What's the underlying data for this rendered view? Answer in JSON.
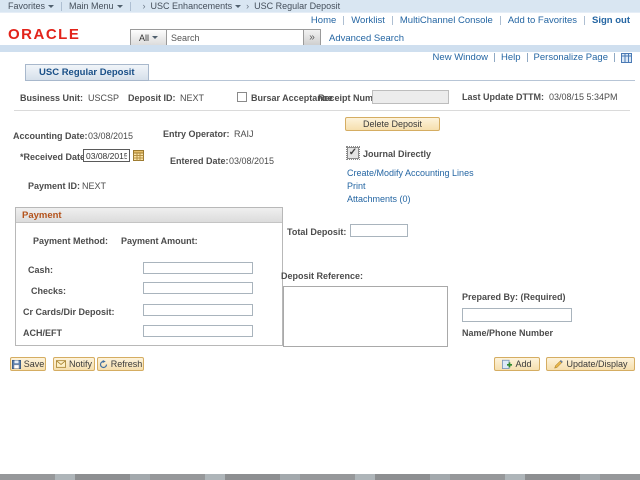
{
  "breadcrumb": {
    "items": [
      {
        "label": "Favorites"
      },
      {
        "label": "Main Menu"
      },
      {
        "label": "USC Enhancements"
      },
      {
        "label": "USC Regular Deposit"
      }
    ],
    "separator": "›"
  },
  "utility_nav": {
    "home": "Home",
    "worklist": "Worklist",
    "multichannel": "MultiChannel Console",
    "add_to_favorites": "Add to Favorites",
    "sign_out": "Sign out"
  },
  "brand": {
    "logo": "ORACLE"
  },
  "search": {
    "scope": "All",
    "placeholder": "Search",
    "go_glyph": "»",
    "advanced": "Advanced Search"
  },
  "pagebar": {
    "new_window": "New Window",
    "help": "Help",
    "personalize": "Personalize Page"
  },
  "tab": {
    "label": "USC Regular Deposit"
  },
  "deposit_header": {
    "business_unit_label": "Business Unit:",
    "business_unit_value": "USCSP",
    "deposit_id_label": "Deposit ID:",
    "deposit_id_value": "NEXT",
    "bursar_label": "Bursar Acceptance",
    "bursar_checked": false,
    "receipt_number_label": "Receipt Number",
    "receipt_number_value": "",
    "last_update_label": "Last Update DTTM:",
    "last_update_value": "03/08/15 5:34PM"
  },
  "deposit_fields": {
    "accounting_date_label": "Accounting Date:",
    "accounting_date_value": "03/08/2015",
    "entry_operator_label": "Entry Operator:",
    "entry_operator_value": "RAIJ",
    "received_date_label": "*Received Date:",
    "received_date_value": "03/08/2015",
    "entered_date_label": "Entered Date:",
    "entered_date_value": "03/08/2015",
    "payment_id_label": "Payment ID:",
    "payment_id_value": "NEXT",
    "journal_directly_label": "Journal Directly",
    "journal_checked": true,
    "journal_check_glyph": "✓",
    "delete_button": "Delete Deposit",
    "links": {
      "accounting_lines": "Create/Modify Accounting Lines",
      "print": "Print",
      "attachments": "Attachments (0)"
    }
  },
  "payment_box": {
    "title": "Payment",
    "method_header": "Payment Method:",
    "amount_header": "Payment Amount:",
    "rows": [
      {
        "label": "Cash:",
        "value": ""
      },
      {
        "label": "Checks:",
        "value": ""
      },
      {
        "label": "Cr Cards/Dir Deposit:",
        "value": ""
      },
      {
        "label": "ACH/EFT",
        "value": ""
      }
    ]
  },
  "totals": {
    "total_deposit_label": "Total Deposit:",
    "total_deposit_value": "",
    "deposit_reference_label": "Deposit Reference:",
    "deposit_reference_value": "",
    "prepared_by_label": "Prepared By: (Required)",
    "prepared_by_value": "",
    "name_phone_label": "Name/Phone Number"
  },
  "toolbar": {
    "save": "Save",
    "notify": "Notify",
    "refresh": "Refresh",
    "add": "Add",
    "update_display": "Update/Display"
  },
  "colors": {
    "link_blue": "#2566a3",
    "oracle_red": "#e2231a",
    "button_tan": "#f6dfae",
    "payment_title_orange": "#b4531c",
    "topbar_blue": "#d9e6f2"
  }
}
